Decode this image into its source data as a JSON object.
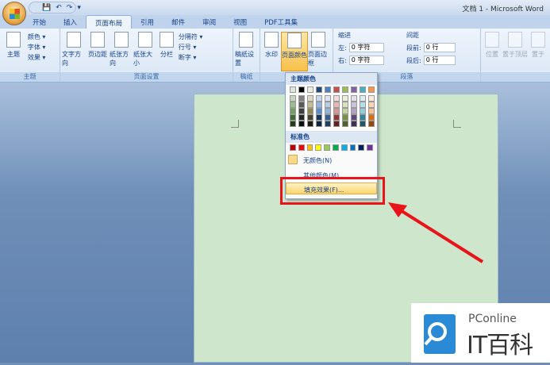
{
  "window": {
    "title": "文档 1 - Microsoft Word",
    "qat": [
      "💾",
      "↶",
      "↷",
      "▾"
    ]
  },
  "tabs": [
    "开始",
    "插入",
    "页面布局",
    "引用",
    "邮件",
    "审阅",
    "视图",
    "PDF工具集"
  ],
  "ribbon": {
    "theme": {
      "label": "主题",
      "big": "主题",
      "items": [
        "颜色 ▾",
        "字体 ▾",
        "效果 ▾"
      ]
    },
    "page_setup": {
      "label": "页面设置",
      "buttons": [
        "文字方向",
        "页边距",
        "纸张方向",
        "纸张大小",
        "分栏"
      ],
      "items": [
        "分隔符 ▾",
        "行号 ▾",
        "断字 ▾"
      ]
    },
    "draft": {
      "label": "稿纸",
      "button": "稿纸设置"
    },
    "background": {
      "buttons": [
        "水印",
        "页面颜色",
        "页面边框"
      ]
    },
    "paragraph": {
      "label": "段落",
      "indent": "缩进",
      "spacing": "间距",
      "left": "左:",
      "right": "右:",
      "before": "段前:",
      "after": "段后:",
      "left_val": "0 字符",
      "right_val": "0 字符",
      "before_val": "0 行",
      "after_val": "0 行"
    },
    "arrange": {
      "buttons": [
        "位置",
        "置于顶层",
        "置于"
      ]
    }
  },
  "menu": {
    "theme_header": "主题颜色",
    "theme_colors": [
      [
        "#dde9d8",
        "#c6d9c0",
        "#9cbd92",
        "#6f9f63",
        "#3f6b36",
        "#243d1f"
      ],
      [
        "#000000",
        "#7f7f7f",
        "#595959",
        "#3f3f3f",
        "#262626",
        "#0d0d0d"
      ],
      [
        "#eeece1",
        "#ddd9c3",
        "#c4bd97",
        "#938953",
        "#4a452a",
        "#1d1b10"
      ],
      [
        "#1f497d",
        "#c6d9f0",
        "#8db3e2",
        "#548dd4",
        "#17365d",
        "#0f243e"
      ],
      [
        "#4f81bd",
        "#dbe5f1",
        "#b8cce4",
        "#95b3d7",
        "#366092",
        "#244061"
      ],
      [
        "#c0504d",
        "#f2dcdb",
        "#e5b9b7",
        "#d99694",
        "#953734",
        "#632423"
      ],
      [
        "#9bbb59",
        "#ebf1dd",
        "#d7e3bc",
        "#c3d69b",
        "#76923c",
        "#4f6128"
      ],
      [
        "#8064a2",
        "#e5e0ec",
        "#ccc1d9",
        "#b2a2c7",
        "#5f497a",
        "#3f3151"
      ],
      [
        "#4bacc6",
        "#dbeef3",
        "#b7dde8",
        "#92cddc",
        "#31859b",
        "#205867"
      ],
      [
        "#f79646",
        "#fdeada",
        "#fbd5b5",
        "#fac08f",
        "#e36c09",
        "#974806"
      ]
    ],
    "standard_header": "标准色",
    "standard_colors": [
      "#c00000",
      "#ff0000",
      "#ffc000",
      "#ffff00",
      "#92d050",
      "#00b050",
      "#00b0f0",
      "#0070c0",
      "#002060",
      "#7030a0"
    ],
    "no_color": "无颜色(N)",
    "more_colors": "其他颜色(M)...",
    "fill_effects": "填充效果(F)..."
  },
  "page_color": "#cde6cc",
  "highlight_color": "#e8141a",
  "logo": {
    "top": "PConline",
    "bottom": "IT百科"
  }
}
